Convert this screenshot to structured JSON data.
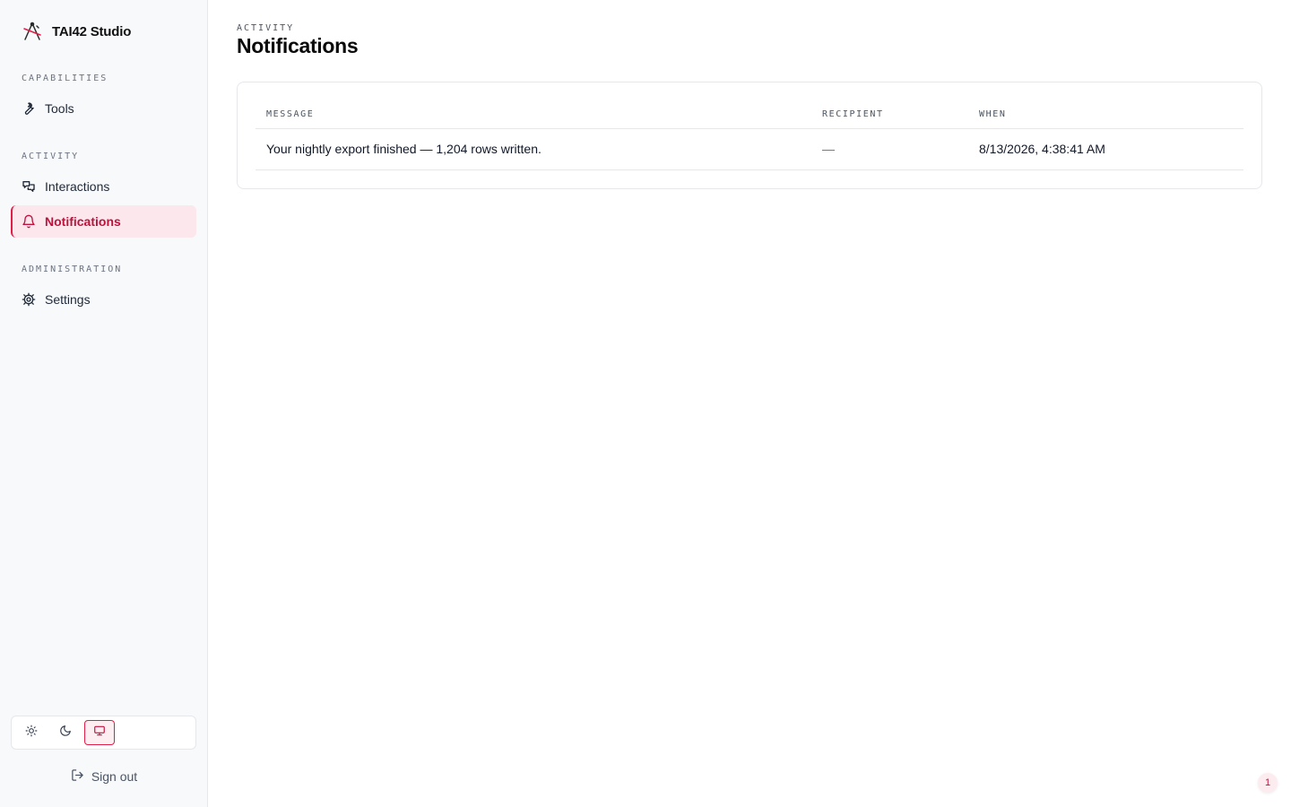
{
  "brand": {
    "name": "TAI42 Studio",
    "logo_icon": "compass-tools-icon",
    "accent": "#e11d48"
  },
  "sidebar": {
    "sections": [
      {
        "label": "CAPABILITIES",
        "items": [
          {
            "label": "Tools",
            "icon": "wrench-icon",
            "active": false
          }
        ]
      },
      {
        "label": "ACTIVITY",
        "items": [
          {
            "label": "Interactions",
            "icon": "chat-bubbles-icon",
            "active": false
          },
          {
            "label": "Notifications",
            "icon": "bell-icon",
            "active": true
          }
        ]
      },
      {
        "label": "ADMINISTRATION",
        "items": [
          {
            "label": "Settings",
            "icon": "gear-icon",
            "active": false
          }
        ]
      }
    ],
    "theme_options": [
      {
        "icon": "sun-icon",
        "active": false
      },
      {
        "icon": "moon-icon",
        "active": false
      },
      {
        "icon": "monitor-icon",
        "active": true
      }
    ],
    "signout_label": "Sign out"
  },
  "header": {
    "eyebrow": "ACTIVITY",
    "title": "Notifications"
  },
  "table": {
    "columns": [
      "MESSAGE",
      "RECIPIENT",
      "WHEN"
    ],
    "rows": [
      {
        "message": "Your nightly export finished — 1,204 rows written.",
        "recipient": "—",
        "when": "8/13/2026, 4:38:41 AM"
      }
    ]
  },
  "corner_badge": "1"
}
